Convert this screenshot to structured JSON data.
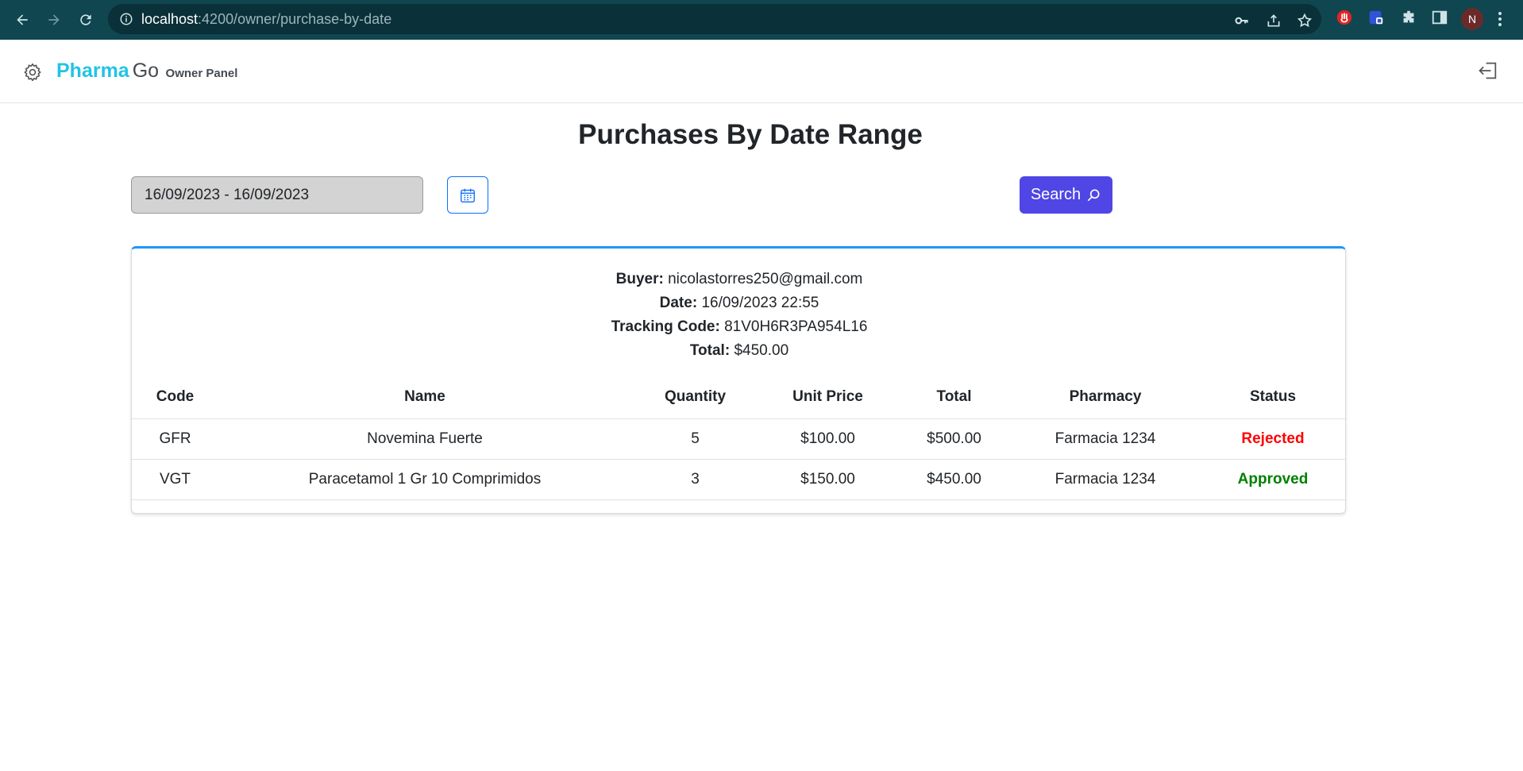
{
  "browser": {
    "url_host": "localhost",
    "url_path": ":4200/owner/purchase-by-date",
    "profile_initial": "N"
  },
  "navbar": {
    "brand_primary": "Pharma",
    "brand_secondary": "Go",
    "panel_label": "Owner Panel"
  },
  "page": {
    "title": "Purchases By Date Range"
  },
  "filters": {
    "date_range_value": "16/09/2023 - 16/09/2023",
    "search_label": "Search"
  },
  "purchase": {
    "buyer_label": "Buyer:",
    "buyer": "nicolastorres250@gmail.com",
    "date_label": "Date:",
    "date": "16/09/2023 22:55",
    "tracking_label": "Tracking Code:",
    "tracking_code": "81V0H6R3PA954L16",
    "total_label": "Total:",
    "total": "$450.00"
  },
  "table": {
    "headers": [
      "Code",
      "Name",
      "Quantity",
      "Unit Price",
      "Total",
      "Pharmacy",
      "Status"
    ],
    "rows": [
      {
        "code": "GFR",
        "name": "Novemina Fuerte",
        "quantity": "5",
        "unit_price": "$100.00",
        "total": "$500.00",
        "pharmacy": "Farmacia 1234",
        "status": "Rejected",
        "status_color": "#ff0000"
      },
      {
        "code": "VGT",
        "name": "Paracetamol 1 Gr 10 Comprimidos",
        "quantity": "3",
        "unit_price": "$150.00",
        "total": "$450.00",
        "pharmacy": "Farmacia 1234",
        "status": "Approved",
        "status_color": "#008000"
      }
    ]
  },
  "colors": {
    "chrome_bg": "#0f4650",
    "brand_accent": "#22c3e6",
    "search_button": "#4f46e5",
    "card_top_border": "#2196f3"
  },
  "icons": [
    "back-arrow-icon",
    "forward-arrow-icon",
    "reload-icon",
    "site-info-icon",
    "key-icon",
    "share-icon",
    "star-icon",
    "extension-icon",
    "puzzle-icon",
    "side-panel-icon",
    "kebab-menu-icon",
    "gear-icon",
    "logout-icon",
    "calendar-icon",
    "search-icon"
  ]
}
